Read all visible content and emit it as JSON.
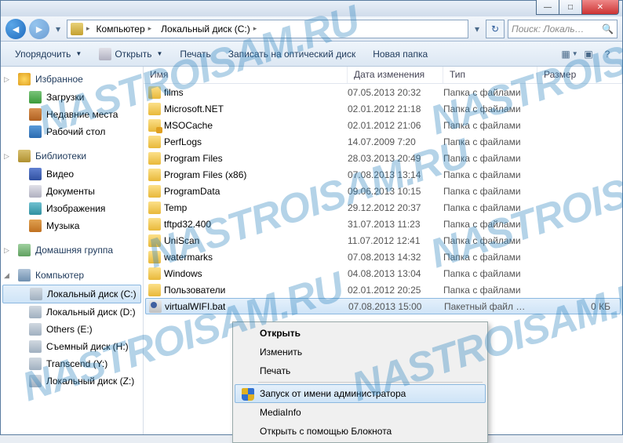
{
  "titlebar": {
    "min": "—",
    "max": "□",
    "close": "✕"
  },
  "nav": {
    "back": "◄",
    "fwd": "►",
    "drop": "▾",
    "segments": [
      "Компьютер",
      "Локальный диск (C:)"
    ],
    "refresh": "↻",
    "search_placeholder": "Поиск: Локаль…",
    "search_icon": "🔍"
  },
  "toolbar": {
    "organize": "Упорядочить",
    "open": "Открыть",
    "print": "Печать",
    "burn": "Записать на оптический диск",
    "newfolder": "Новая папка",
    "view": "▦",
    "help": "?"
  },
  "sidebar": {
    "favorites": "Избранное",
    "downloads": "Загрузки",
    "recent": "Недавние места",
    "desktop": "Рабочий стол",
    "libraries": "Библиотеки",
    "videos": "Видео",
    "documents": "Документы",
    "pictures": "Изображения",
    "music": "Музыка",
    "homegroup": "Домашняя группа",
    "computer": "Компьютер",
    "drive_c": "Локальный диск (C:)",
    "drive_d": "Локальный диск (D:)",
    "drive_e": "Others (E:)",
    "drive_h": "Съемный диск (H:)",
    "drive_y": "Transcend (Y:)",
    "drive_z": "Локальный диск (Z:)"
  },
  "headers": {
    "name": "Имя",
    "date": "Дата изменения",
    "type": "Тип",
    "size": "Размер"
  },
  "files": [
    {
      "name": "films",
      "date": "07.05.2013 20:32",
      "type": "Папка с файлами",
      "icon": "folder"
    },
    {
      "name": "Microsoft.NET",
      "date": "02.01.2012 21:18",
      "type": "Папка с файлами",
      "icon": "folder"
    },
    {
      "name": "MSOCache",
      "date": "02.01.2012 21:06",
      "type": "Папка с файлами",
      "icon": "folder-lock"
    },
    {
      "name": "PerfLogs",
      "date": "14.07.2009 7:20",
      "type": "Папка с файлами",
      "icon": "folder"
    },
    {
      "name": "Program Files",
      "date": "28.03.2013 20:49",
      "type": "Папка с файлами",
      "icon": "folder"
    },
    {
      "name": "Program Files (x86)",
      "date": "07.08.2013 13:14",
      "type": "Папка с файлами",
      "icon": "folder"
    },
    {
      "name": "ProgramData",
      "date": "09.06.2013 10:15",
      "type": "Папка с файлами",
      "icon": "folder"
    },
    {
      "name": "Temp",
      "date": "29.12.2012 20:37",
      "type": "Папка с файлами",
      "icon": "folder"
    },
    {
      "name": "tftpd32.400",
      "date": "31.07.2013 11:23",
      "type": "Папка с файлами",
      "icon": "folder"
    },
    {
      "name": "UniScan",
      "date": "11.07.2012 12:41",
      "type": "Папка с файлами",
      "icon": "folder"
    },
    {
      "name": "watermarks",
      "date": "07.08.2013 14:32",
      "type": "Папка с файлами",
      "icon": "folder"
    },
    {
      "name": "Windows",
      "date": "04.08.2013 13:04",
      "type": "Папка с файлами",
      "icon": "folder"
    },
    {
      "name": "Пользователи",
      "date": "02.01.2012 20:25",
      "type": "Папка с файлами",
      "icon": "folder"
    },
    {
      "name": "virtualWIFI.bat",
      "date": "07.08.2013 15:00",
      "type": "Пакетный файл …",
      "size": "0 КБ",
      "icon": "bat",
      "selected": true
    }
  ],
  "context": {
    "open": "Открыть",
    "edit": "Изменить",
    "print": "Печать",
    "runas": "Запуск от имени администратора",
    "mediainfo": "MediaInfo",
    "notepad": "Открыть с помощью Блокнота"
  },
  "watermark": "NASTROISAM.RU"
}
